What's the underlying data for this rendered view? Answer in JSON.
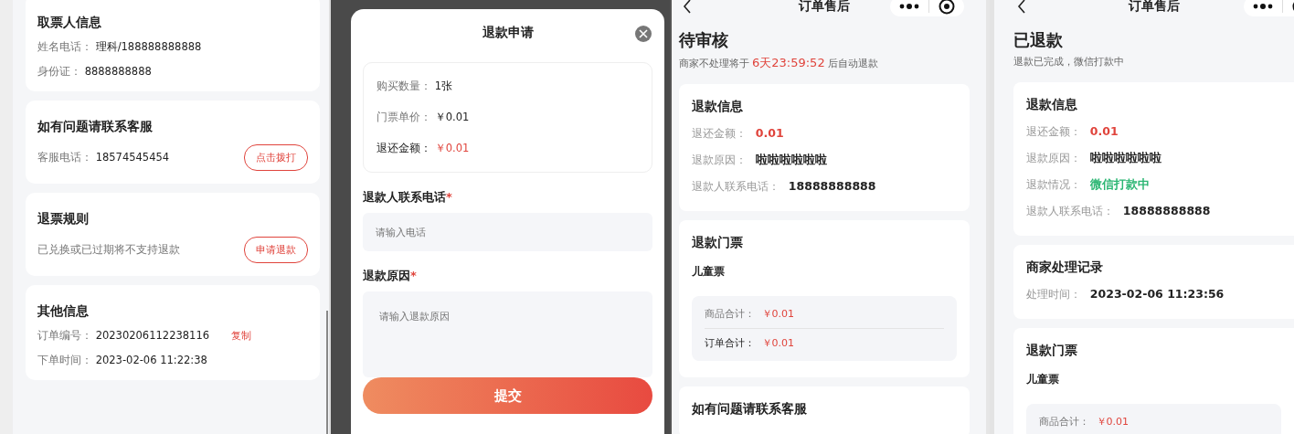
{
  "order_detail": {
    "cards": [
      {
        "title": "取票人信息",
        "rows": [
          {
            "label": "姓名电话：",
            "value": "理科/188888888888"
          },
          {
            "label": "身份证：",
            "value": "8888888888"
          }
        ]
      },
      {
        "title": "如有问题请联系客服",
        "rows": [
          {
            "label": "客服电话：",
            "value": "18574545454"
          }
        ],
        "action": "点击拨打"
      },
      {
        "title": "退票规则",
        "rows": [
          {
            "note": "已兑换或已过期将不支持退款"
          }
        ],
        "action": "申请退款"
      },
      {
        "title": "其他信息",
        "rows": [
          {
            "label": "订单编号：",
            "value": "20230206112238116",
            "link": "复制"
          },
          {
            "label": "下单时间：",
            "value": "2023-02-06 11:22:38"
          }
        ]
      }
    ]
  },
  "refund_dialog": {
    "title": "退款申请",
    "summary": [
      {
        "label": "购买数量：",
        "value": "1张",
        "color": "#222222",
        "emphasis": false
      },
      {
        "label": "门票单价：",
        "value": "￥0.01",
        "color": "#222222",
        "emphasis": false
      },
      {
        "label": "退还金额：",
        "value": "￥0.01",
        "color": "#e0443c",
        "emphasis": true
      }
    ],
    "fields": [
      {
        "kind": "input",
        "label": "退款人联系电话",
        "required_mark": "*",
        "placeholder": "请输入电话"
      },
      {
        "kind": "textarea",
        "label": "退款原因",
        "required_mark": "*",
        "placeholder": "请输入退款原因"
      }
    ],
    "submit": "提交"
  },
  "after_sale_pending": {
    "nav_title": "订单售后",
    "status": "待审核",
    "notice_before": "商家不处理将于",
    "countdown": "6天23:59:52",
    "notice_after": "后自动退款",
    "cards": [
      {
        "title": "退款信息",
        "rows": [
          {
            "label": "退还金额：",
            "value": "0.01",
            "color": "#e0443c"
          },
          {
            "label": "退款原因：",
            "value": "啦啦啦啦啦啦",
            "color": "#222222"
          },
          {
            "label": "退款人联系电话：",
            "value": "18888888888",
            "color": "#222222"
          }
        ]
      },
      {
        "title": "退款门票",
        "item": "儿童票",
        "totals": [
          {
            "label": "商品合计：",
            "value": "￥0.01",
            "emphasis": false
          },
          {
            "label": "订单合计：",
            "value": "￥0.01",
            "emphasis": true
          }
        ]
      },
      {
        "title": "如有问题请联系客服"
      }
    ]
  },
  "after_sale_refunded": {
    "nav_title": "订单售后",
    "status": "已退款",
    "subtitle": "退款已完成，微信打款中",
    "cards": [
      {
        "title": "退款信息",
        "rows": [
          {
            "label": "退还金额：",
            "value": "0.01",
            "color": "#e0443c"
          },
          {
            "label": "退款原因：",
            "value": "啦啦啦啦啦啦",
            "color": "#222222"
          },
          {
            "label": "退款情况：",
            "value": "微信打款中",
            "color": "#2bb673"
          },
          {
            "label": "退款人联系电话：",
            "value": "18888888888",
            "color": "#222222"
          }
        ]
      },
      {
        "title": "商家处理记录",
        "rows": [
          {
            "label": "处理时间：",
            "value": "2023-02-06 11:23:56",
            "color": "#222222"
          }
        ]
      },
      {
        "title": "退款门票",
        "item": "儿童票",
        "totals": [
          {
            "label": "商品合计：",
            "value": "￥0.01",
            "emphasis": false
          }
        ]
      }
    ]
  }
}
